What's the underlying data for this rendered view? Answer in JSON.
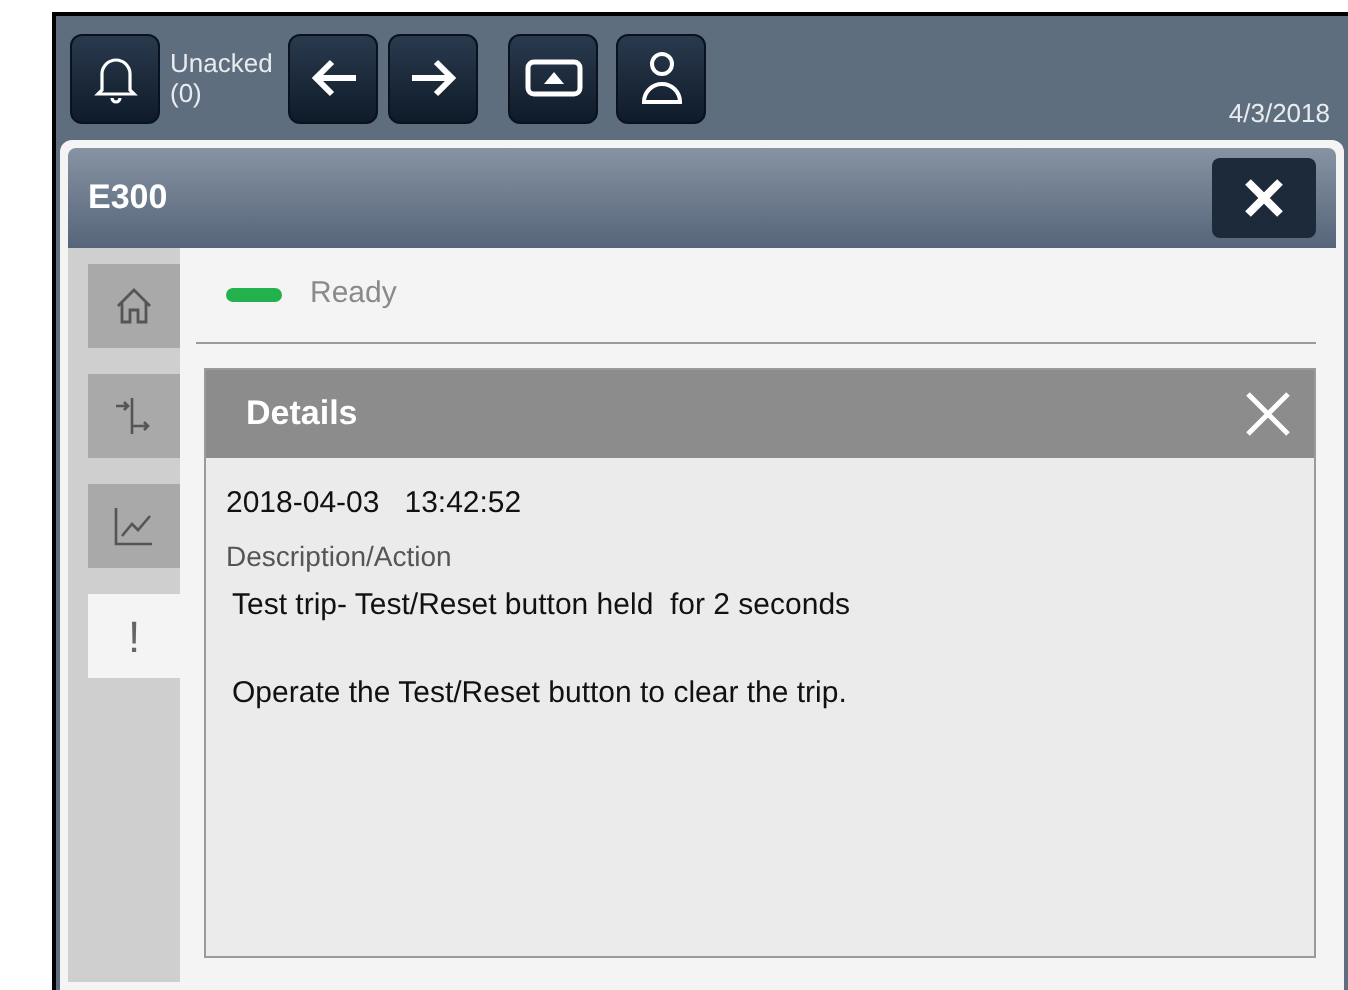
{
  "toolbar": {
    "alarm_label": "Unacked",
    "alarm_count": "(0)",
    "buttons": [
      {
        "kind": "back"
      },
      {
        "kind": "forward"
      },
      {
        "kind": "display"
      },
      {
        "kind": "user"
      }
    ],
    "date": "4/3/2018"
  },
  "window": {
    "title": "E300"
  },
  "side_tabs": [
    {
      "kind": "home",
      "selected": false
    },
    {
      "kind": "io",
      "selected": false
    },
    {
      "kind": "trend",
      "selected": false
    },
    {
      "kind": "alarm",
      "label": "!",
      "selected": true
    }
  ],
  "status": {
    "text": "Ready",
    "color": "#22b14c"
  },
  "details": {
    "title": "Details",
    "timestamp": "2018-04-03   13:42:52",
    "section_label": "Description/Action",
    "lines": [
      "Test trip- Test/Reset button held  for 2 seconds",
      "Operate the Test/Reset button to clear the trip."
    ]
  }
}
